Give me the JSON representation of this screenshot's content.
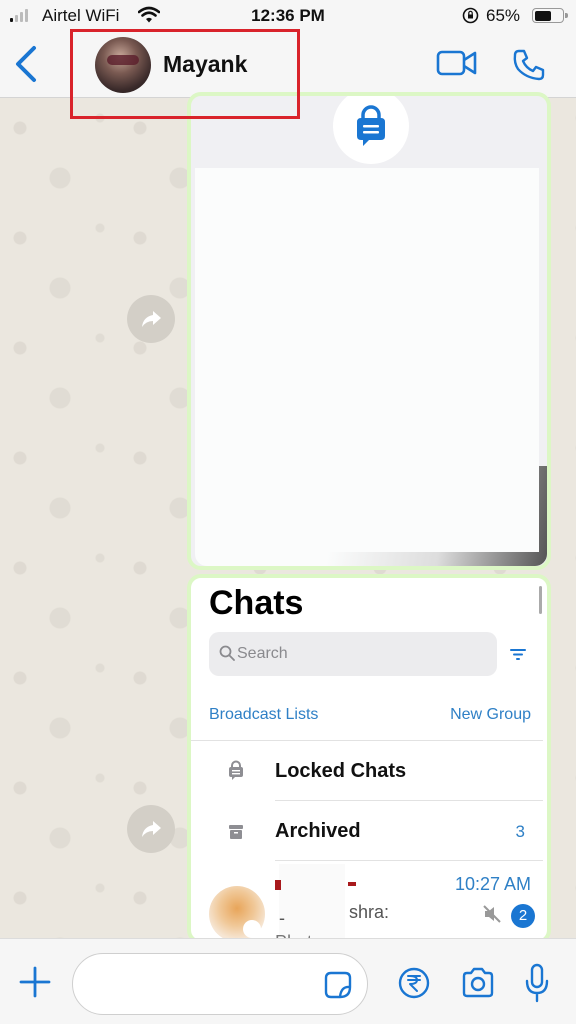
{
  "status_bar": {
    "carrier": "Airtel WiFi",
    "time": "12:36 PM",
    "battery_percent": "65%",
    "battery_level": 0.65
  },
  "header": {
    "back_icon": "chevron-left-icon",
    "contact_name": "Mayank",
    "video_call_icon": "video-camera-icon",
    "voice_call_icon": "phone-icon"
  },
  "messages": [
    {
      "type": "image",
      "icon": "lock-chat-icon",
      "content": "screenshot (blank)"
    },
    {
      "type": "image",
      "content": "chats screenshot",
      "screenshot": {
        "title": "Chats",
        "search_placeholder": "Search",
        "filter_icon": "filter-icon",
        "links": {
          "broadcast": "Broadcast Lists",
          "new_group": "New Group"
        },
        "rows": [
          {
            "icon": "lock-chat-icon",
            "label": "Locked Chats",
            "count": ""
          },
          {
            "icon": "archive-icon",
            "label": "Archived",
            "count": "3"
          }
        ],
        "chat": {
          "sender_partial": "shra:",
          "dash": "-",
          "preview": "Photo",
          "time": "10:27 AM",
          "unread": "2",
          "muted": true
        }
      }
    }
  ],
  "input_bar": {
    "message_placeholder": "",
    "plus_icon": "plus-icon",
    "sticker_icon": "sticker-icon",
    "payment_icon": "rupee-icon",
    "camera_icon": "camera-icon",
    "mic_icon": "microphone-icon"
  },
  "colors": {
    "accent": "#1a76d2",
    "link": "#2f80c6",
    "highlight_box": "#d9232b",
    "bubble_border": "#dcf7c5"
  }
}
